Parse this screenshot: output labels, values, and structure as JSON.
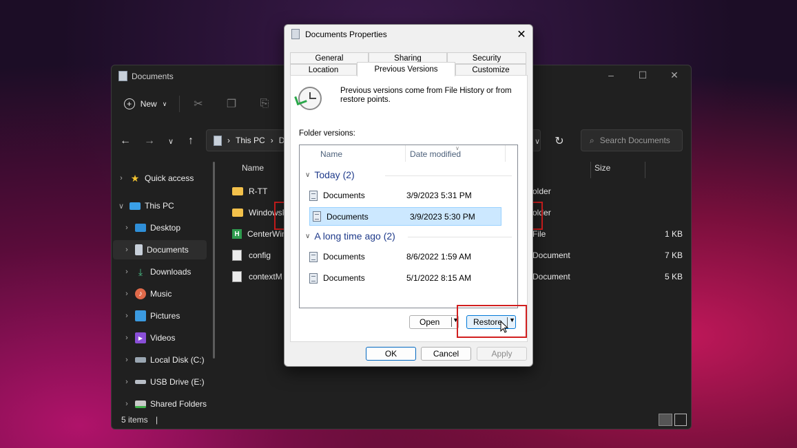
{
  "explorer": {
    "title": "Documents",
    "new_label": "New",
    "breadcrumb": [
      "This PC",
      "D"
    ],
    "search_placeholder": "Search Documents",
    "columns": {
      "name": "Name",
      "size": "Size"
    },
    "sidebar": [
      {
        "label": "Quick access",
        "icon": "star-icon"
      },
      {
        "label": "This PC",
        "icon": "computer-icon"
      },
      {
        "label": "Desktop",
        "icon": "desktop-icon"
      },
      {
        "label": "Documents",
        "icon": "documents-icon"
      },
      {
        "label": "Downloads",
        "icon": "downloads-icon"
      },
      {
        "label": "Music",
        "icon": "music-icon"
      },
      {
        "label": "Pictures",
        "icon": "pictures-icon"
      },
      {
        "label": "Videos",
        "icon": "videos-icon"
      },
      {
        "label": "Local Disk (C:)",
        "icon": "disk-icon"
      },
      {
        "label": "USB Drive (E:)",
        "icon": "usb-icon"
      },
      {
        "label": "Shared Folders",
        "icon": "network-folder-icon"
      }
    ],
    "files": [
      {
        "name": "R-TT",
        "type": "older",
        "size": ""
      },
      {
        "name": "WindowsP",
        "type": "older",
        "size": ""
      },
      {
        "name": "CenterWin",
        "type": "File",
        "size": "1 KB"
      },
      {
        "name": "config",
        "type": "Document",
        "size": "7 KB"
      },
      {
        "name": "contextM",
        "type": "Document",
        "size": "5 KB"
      }
    ],
    "status": "5 items"
  },
  "dialog": {
    "title": "Documents Properties",
    "tabs_row1": [
      "General",
      "Sharing",
      "Security"
    ],
    "tabs_row2": [
      "Location",
      "Previous Versions",
      "Customize"
    ],
    "info": "Previous versions come from File History or from restore points.",
    "folder_versions_label": "Folder versions:",
    "columns": {
      "name": "Name",
      "date": "Date modified"
    },
    "groups": [
      {
        "label": "Today (2)",
        "items": [
          {
            "name": "Documents",
            "date": "3/9/2023 5:31 PM"
          },
          {
            "name": "Documents",
            "date": "3/9/2023 5:30 PM"
          }
        ]
      },
      {
        "label": "A long time ago (2)",
        "items": [
          {
            "name": "Documents",
            "date": "8/6/2022 1:59 AM"
          },
          {
            "name": "Documents",
            "date": "5/1/2022 8:15 AM"
          }
        ]
      }
    ],
    "open_label": "Open",
    "restore_label": "Restore",
    "ok_label": "OK",
    "cancel_label": "Cancel",
    "apply_label": "Apply"
  },
  "colors": {
    "highlight": "#d11e1e",
    "selection": "#cce8ff",
    "accent": "#0067c0"
  }
}
